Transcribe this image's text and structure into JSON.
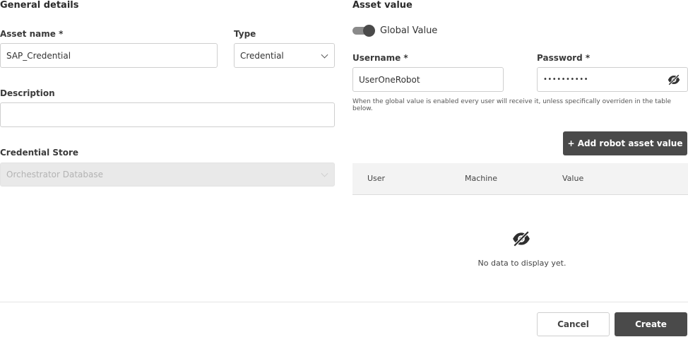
{
  "general": {
    "title": "General details",
    "asset_name_label": "Asset name *",
    "asset_name_value": "SAP_Credential",
    "type_label": "Type",
    "type_value": "Credential",
    "description_label": "Description",
    "description_value": "",
    "credential_store_label": "Credential Store",
    "credential_store_value": "Orchestrator Database"
  },
  "asset_value": {
    "title": "Asset value",
    "global_toggle_label": "Global Value",
    "global_toggle_on": true,
    "username_label": "Username *",
    "username_value": "UserOneRobot",
    "password_label": "Password *",
    "password_value": "••••••••••",
    "helper_text": "When the global value is enabled every user will receive it, unless specifically overriden in the table below.",
    "add_button_label": "+  Add robot asset value",
    "table": {
      "columns": [
        "User",
        "Machine",
        "Value"
      ],
      "rows": [],
      "empty_text": "No data to display yet."
    }
  },
  "footer": {
    "cancel_label": "Cancel",
    "create_label": "Create"
  },
  "icons": {
    "visibility_off": "eye-off-icon",
    "dropdown": "chevron-down-icon"
  },
  "colors": {
    "primary_dark": "#4a4a4a",
    "disabled_bg": "#e9e9e9"
  }
}
